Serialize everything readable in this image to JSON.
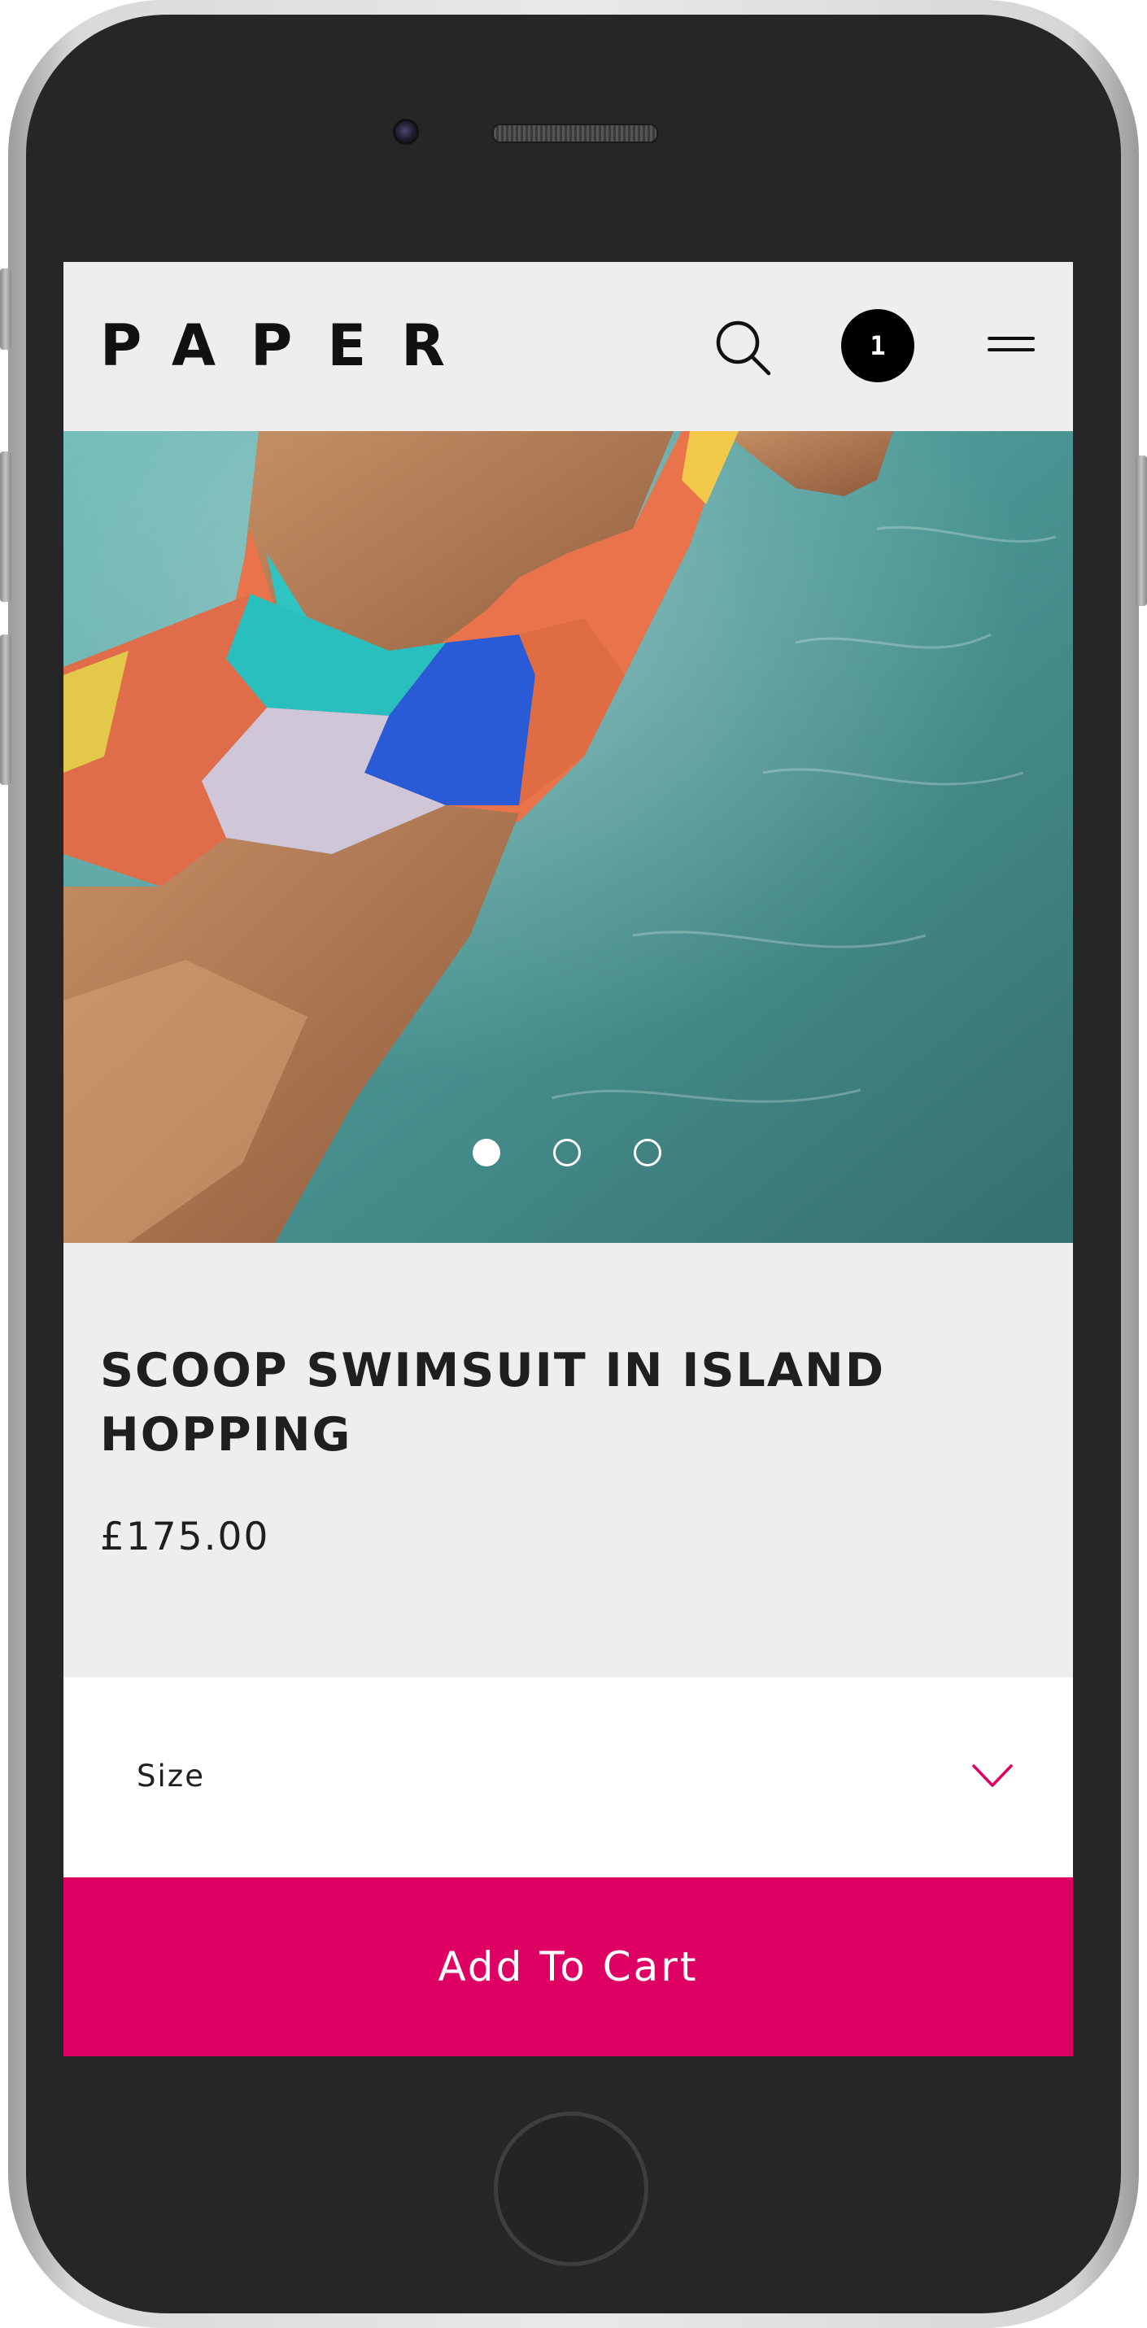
{
  "header": {
    "logo": "PAPER",
    "cart_count": "1",
    "search_icon": "search-icon",
    "menu_icon": "hamburger-menu-icon"
  },
  "gallery": {
    "slide_count": 3,
    "active_slide": 1
  },
  "product": {
    "title": "SCOOP SWIMSUIT IN ISLAND HOPPING",
    "price": "£175.00"
  },
  "size_selector": {
    "label": "Size",
    "icon": "chevron-down-icon"
  },
  "cta": {
    "label": "Add To Cart"
  },
  "colors": {
    "background": "#efedee",
    "accent": "#df0063",
    "text": "#1f1f22"
  }
}
